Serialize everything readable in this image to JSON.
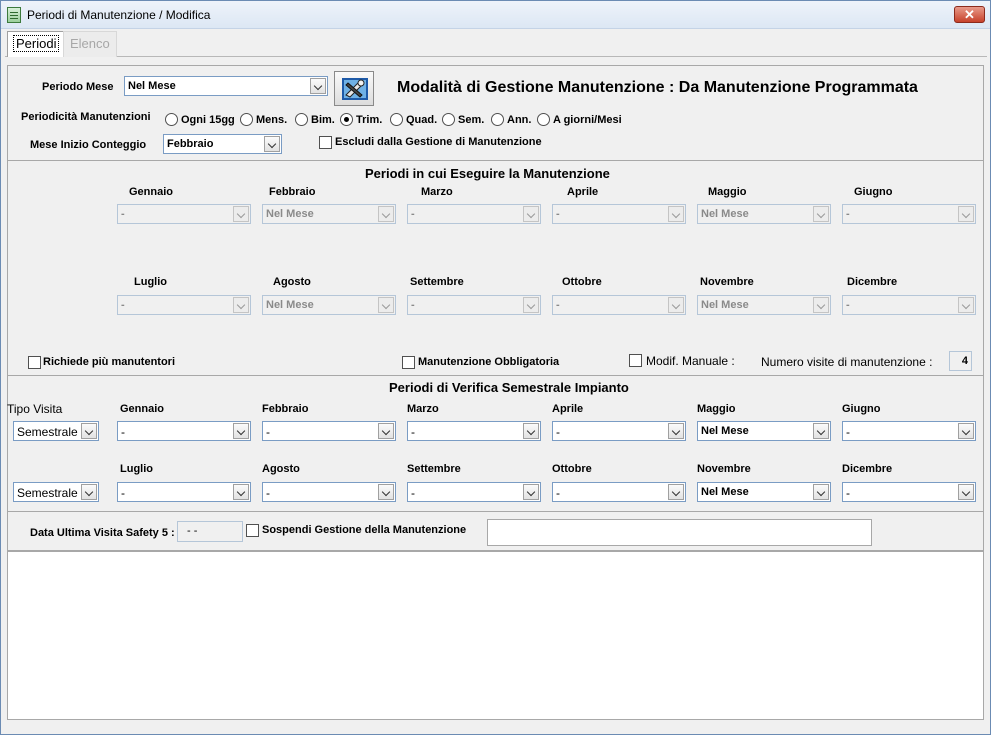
{
  "window": {
    "title": "Periodi di Manutenzione / Modifica",
    "close": "✕"
  },
  "tabs": [
    {
      "label": "Periodi"
    },
    {
      "label": "Elenco"
    }
  ],
  "header": {
    "periodo_mese_label": "Periodo Mese",
    "periodo_mese_value": "Nel Mese",
    "modalita_title": "Modalità di Gestione Manutenzione : Da Manutenzione Programmata",
    "periodicita_label": "Periodicità Manutenzioni",
    "periodicita_options": [
      "Ogni 15gg",
      "Mens.",
      "Bim.",
      "Trim.",
      "Quad.",
      "Sem.",
      "Ann.",
      "A giorni/Mesi"
    ],
    "periodicita_selected": "Trim.",
    "mese_inizio_label": "Mese Inizio Conteggio",
    "mese_inizio_value": "Febbraio",
    "escludi_label": "Escludi dalla Gestione di Manutenzione"
  },
  "periodi_esecuzione": {
    "title": "Periodi in cui Eseguire la Manutenzione",
    "months": [
      "Gennaio",
      "Febbraio",
      "Marzo",
      "Aprile",
      "Maggio",
      "Giugno",
      "Luglio",
      "Agosto",
      "Settembre",
      "Ottobre",
      "Novembre",
      "Dicembre"
    ],
    "values": [
      "-",
      "Nel Mese",
      "-",
      "-",
      "Nel Mese",
      "-",
      "-",
      "Nel Mese",
      "-",
      "-",
      "Nel Mese",
      "-"
    ],
    "richiede_label": "Richiede più manutentori",
    "obbligatoria_label": "Manutenzione Obbligatoria",
    "modif_label": "Modif. Manuale :",
    "numero_visite_label": "Numero visite di manutenzione :",
    "numero_visite_value": "4"
  },
  "verifica": {
    "title": "Periodi di Verifica Semestrale Impianto",
    "tipo_visita_label": "Tipo Visita",
    "tipo_row1": "Semestrale",
    "tipo_row2": "Semestrale",
    "months": [
      "Gennaio",
      "Febbraio",
      "Marzo",
      "Aprile",
      "Maggio",
      "Giugno",
      "Luglio",
      "Agosto",
      "Settembre",
      "Ottobre",
      "Novembre",
      "Dicembre"
    ],
    "values": [
      "-",
      "-",
      "-",
      "-",
      "Nel Mese",
      "-",
      "-",
      "-",
      "-",
      "-",
      "Nel Mese",
      "-"
    ]
  },
  "footer": {
    "data_ultima_label": "Data Ultima Visita Safety 5 :",
    "data_ultima_value": "- -",
    "sospendi_label": "Sospendi Gestione della Manutenzione"
  }
}
